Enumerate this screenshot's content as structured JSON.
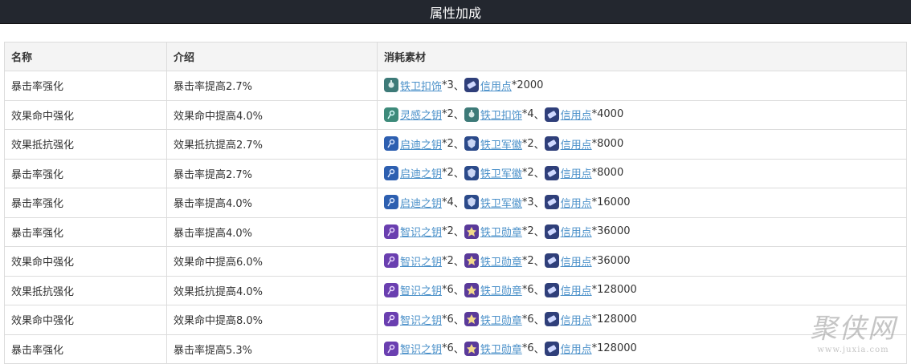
{
  "header": {
    "title": "属性加成"
  },
  "table": {
    "columns": [
      "名称",
      "介绍",
      "消耗素材"
    ],
    "rows": [
      {
        "name": "暴击率强化",
        "desc": "暴击率提高2.7%",
        "materials": [
          {
            "icon": "iron-clasp-icon",
            "color": "#3d7a78",
            "label": "铁卫扣饰",
            "qty": "*3",
            "sep": "、"
          },
          {
            "icon": "credit-icon",
            "color": "#2f3f7a",
            "label": "信用点",
            "qty": "*2000",
            "sep": ""
          }
        ]
      },
      {
        "name": "效果命中强化",
        "desc": "效果命中提高4.0%",
        "materials": [
          {
            "icon": "inspiration-key-icon",
            "color": "#3d8a7a",
            "label": "灵感之钥",
            "qty": "*2",
            "sep": "、"
          },
          {
            "icon": "iron-clasp-icon",
            "color": "#3d7a78",
            "label": "铁卫扣饰",
            "qty": "*4",
            "sep": "、"
          },
          {
            "icon": "credit-icon",
            "color": "#2f3f7a",
            "label": "信用点",
            "qty": "*4000",
            "sep": ""
          }
        ]
      },
      {
        "name": "效果抵抗强化",
        "desc": "效果抵抗提高2.7%",
        "materials": [
          {
            "icon": "enlighten-key-icon",
            "color": "#2d5fb0",
            "label": "启迪之钥",
            "qty": "*2",
            "sep": "、"
          },
          {
            "icon": "iron-insignia-icon",
            "color": "#2b4a8a",
            "label": "铁卫军徽",
            "qty": "*2",
            "sep": "、"
          },
          {
            "icon": "credit-icon",
            "color": "#2f3f7a",
            "label": "信用点",
            "qty": "*8000",
            "sep": ""
          }
        ]
      },
      {
        "name": "暴击率强化",
        "desc": "暴击率提高2.7%",
        "materials": [
          {
            "icon": "enlighten-key-icon",
            "color": "#2d5fb0",
            "label": "启迪之钥",
            "qty": "*2",
            "sep": "、"
          },
          {
            "icon": "iron-insignia-icon",
            "color": "#2b4a8a",
            "label": "铁卫军徽",
            "qty": "*2",
            "sep": "、"
          },
          {
            "icon": "credit-icon",
            "color": "#2f3f7a",
            "label": "信用点",
            "qty": "*8000",
            "sep": ""
          }
        ]
      },
      {
        "name": "暴击率强化",
        "desc": "暴击率提高4.0%",
        "materials": [
          {
            "icon": "enlighten-key-icon",
            "color": "#2d5fb0",
            "label": "启迪之钥",
            "qty": "*4",
            "sep": "、"
          },
          {
            "icon": "iron-insignia-icon",
            "color": "#2b4a8a",
            "label": "铁卫军徽",
            "qty": "*3",
            "sep": "、"
          },
          {
            "icon": "credit-icon",
            "color": "#2f3f7a",
            "label": "信用点",
            "qty": "*16000",
            "sep": ""
          }
        ]
      },
      {
        "name": "暴击率强化",
        "desc": "暴击率提高4.0%",
        "materials": [
          {
            "icon": "wisdom-key-icon",
            "color": "#6a3fb0",
            "label": "智识之钥",
            "qty": "*2",
            "sep": "、"
          },
          {
            "icon": "iron-medal-icon",
            "color": "#5a3a9a",
            "label": "铁卫勋章",
            "qty": "*2",
            "sep": "、"
          },
          {
            "icon": "credit-icon",
            "color": "#2f3f7a",
            "label": "信用点",
            "qty": "*36000",
            "sep": ""
          }
        ]
      },
      {
        "name": "效果命中强化",
        "desc": "效果命中提高6.0%",
        "materials": [
          {
            "icon": "wisdom-key-icon",
            "color": "#6a3fb0",
            "label": "智识之钥",
            "qty": "*2",
            "sep": "、"
          },
          {
            "icon": "iron-medal-icon",
            "color": "#5a3a9a",
            "label": "铁卫勋章",
            "qty": "*2",
            "sep": "、"
          },
          {
            "icon": "credit-icon",
            "color": "#2f3f7a",
            "label": "信用点",
            "qty": "*36000",
            "sep": ""
          }
        ]
      },
      {
        "name": "效果抵抗强化",
        "desc": "效果抵抗提高4.0%",
        "materials": [
          {
            "icon": "wisdom-key-icon",
            "color": "#6a3fb0",
            "label": "智识之钥",
            "qty": "*6",
            "sep": "、"
          },
          {
            "icon": "iron-medal-icon",
            "color": "#5a3a9a",
            "label": "铁卫勋章",
            "qty": "*6",
            "sep": "、"
          },
          {
            "icon": "credit-icon",
            "color": "#2f3f7a",
            "label": "信用点",
            "qty": "*128000",
            "sep": ""
          }
        ]
      },
      {
        "name": "效果命中强化",
        "desc": "效果命中提高8.0%",
        "materials": [
          {
            "icon": "wisdom-key-icon",
            "color": "#6a3fb0",
            "label": "智识之钥",
            "qty": "*6",
            "sep": "、"
          },
          {
            "icon": "iron-medal-icon",
            "color": "#5a3a9a",
            "label": "铁卫勋章",
            "qty": "*6",
            "sep": "、"
          },
          {
            "icon": "credit-icon",
            "color": "#2f3f7a",
            "label": "信用点",
            "qty": "*128000",
            "sep": ""
          }
        ]
      },
      {
        "name": "暴击率强化",
        "desc": "暴击率提高5.3%",
        "materials": [
          {
            "icon": "wisdom-key-icon",
            "color": "#6a3fb0",
            "label": "智识之钥",
            "qty": "*6",
            "sep": "、"
          },
          {
            "icon": "iron-medal-icon",
            "color": "#5a3a9a",
            "label": "铁卫勋章",
            "qty": "*6",
            "sep": "、"
          },
          {
            "icon": "credit-icon",
            "color": "#2f3f7a",
            "label": "信用点",
            "qty": "*128000",
            "sep": ""
          }
        ]
      }
    ]
  },
  "watermark": {
    "brand": "聚侠网",
    "url": "www.juxia.com"
  }
}
